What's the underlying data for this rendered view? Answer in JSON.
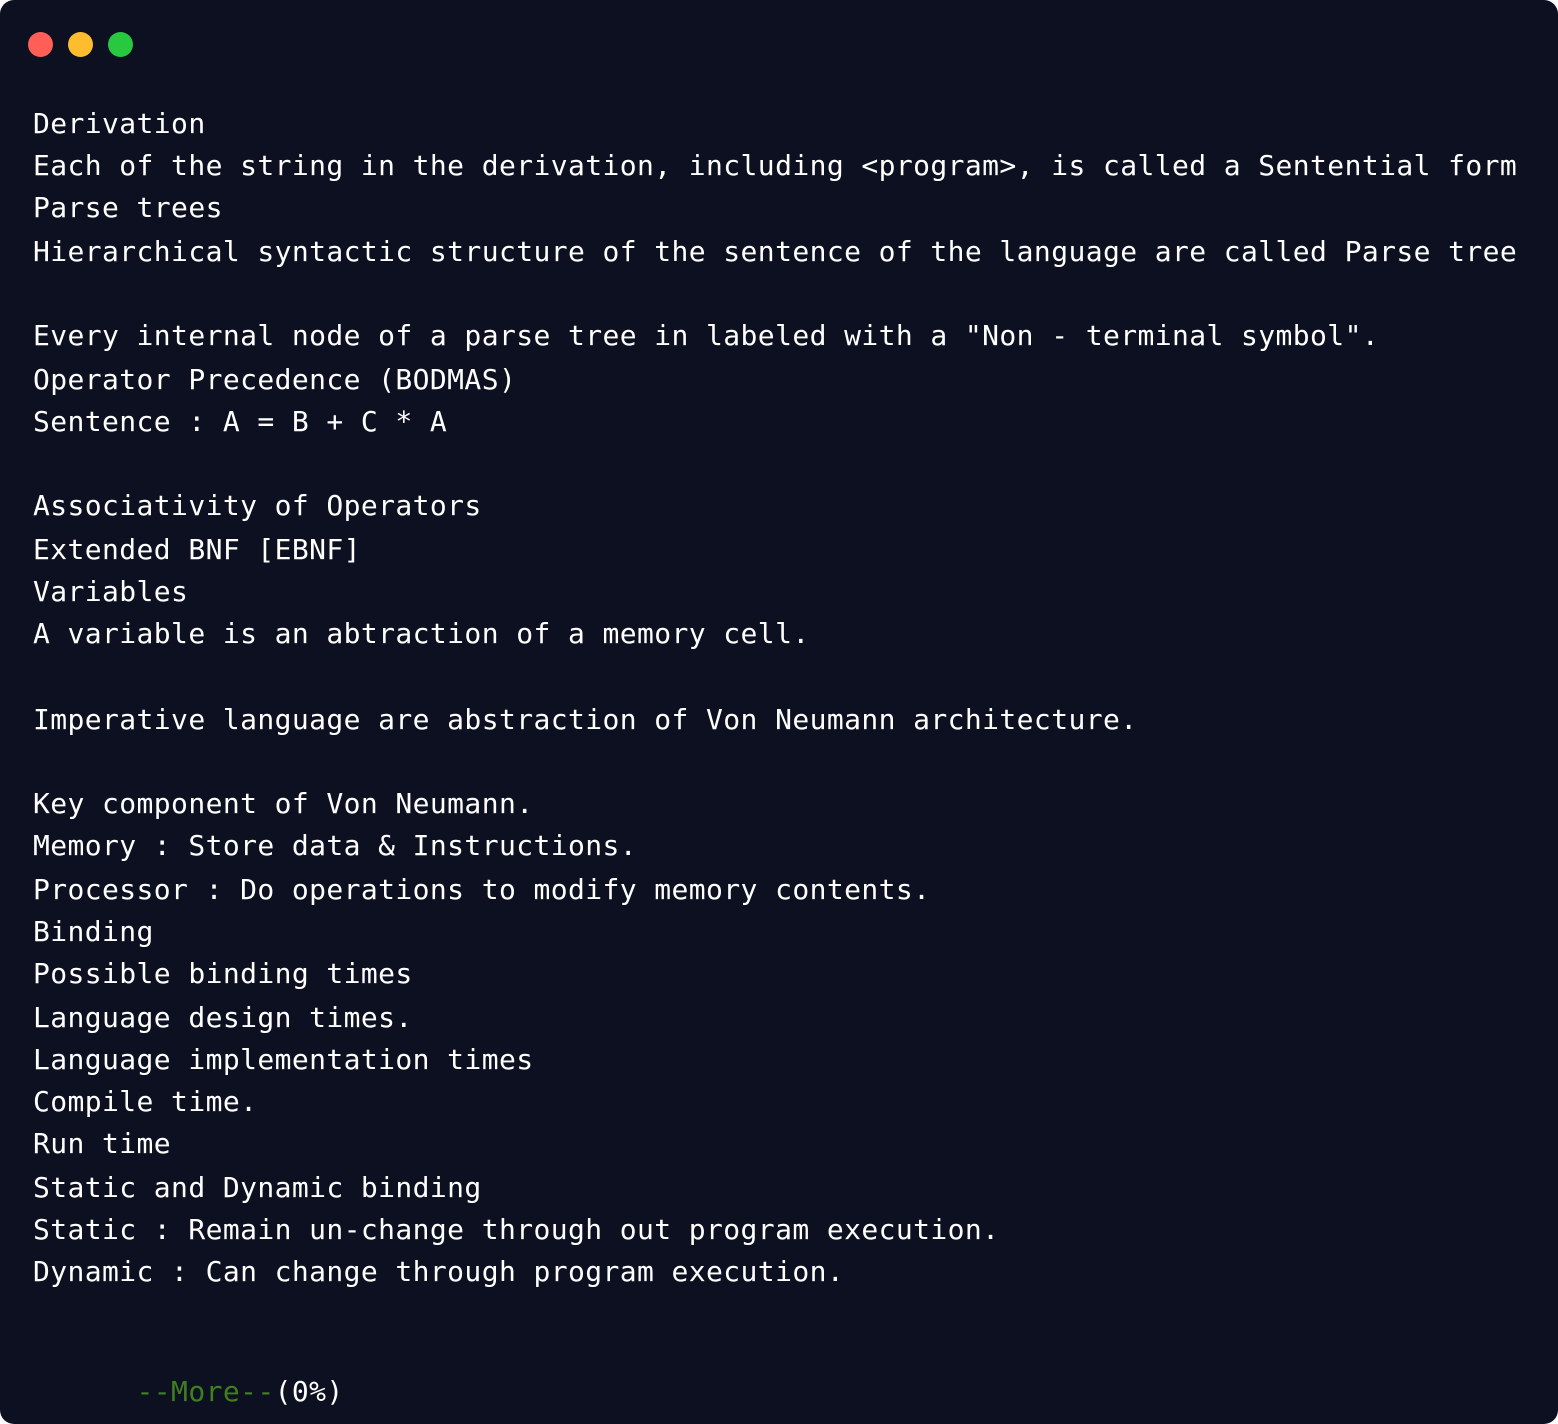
{
  "window": {
    "controls": [
      {
        "name": "close",
        "color": "#ff5f57"
      },
      {
        "name": "minimize",
        "color": "#febc2e"
      },
      {
        "name": "maximize",
        "color": "#28c840"
      }
    ]
  },
  "terminal": {
    "lines": [
      "Derivation",
      "Each of the string in the derivation, including <program>, is called a Sentential form",
      "Parse trees",
      "Hierarchical syntactic structure of the sentence of the language are called Parse tree",
      "Every internal node of a parse tree in labeled with a \"Non - terminal symbol\".",
      "Operator Precedence (BODMAS)",
      "Sentence : A = B + C * A",
      "Associativity of Operators",
      "Extended BNF [EBNF]",
      "Variables",
      "A variable is an abtraction of a memory cell.",
      "Imperative language are abstraction of Von Neumann architecture.",
      "Key component of Von Neumann.",
      "Memory : Store data & Instructions.",
      "Processor : Do operations to modify memory contents.",
      "Binding",
      "Possible binding times",
      "Language design times.",
      "Language implementation times",
      "Compile time.",
      "Run time",
      "Static and Dynamic binding",
      "Static : Remain un-change through out program execution.",
      "Dynamic : Can change through program execution."
    ],
    "pager": {
      "tag": "--More--",
      "percent": "(0%)"
    }
  }
}
